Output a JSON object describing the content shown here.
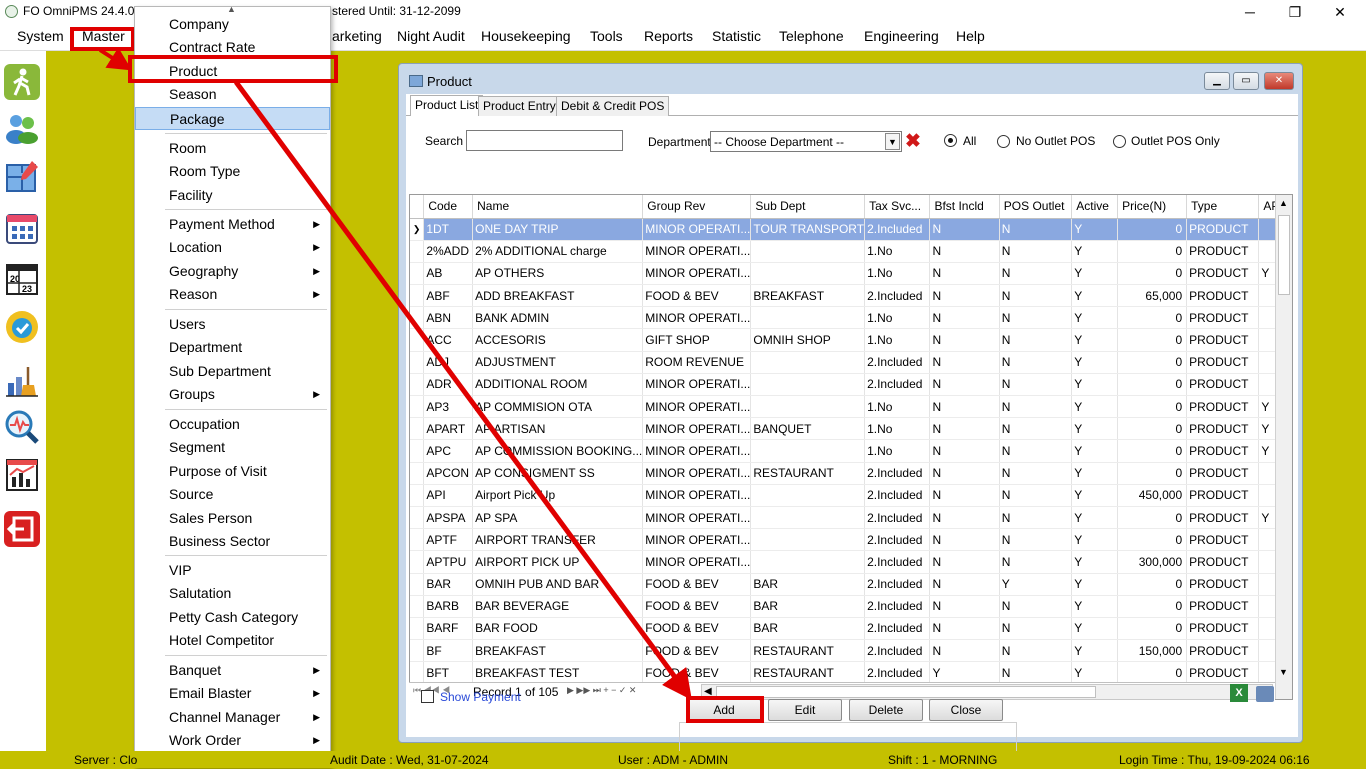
{
  "app": {
    "title": "FO OmniPMS 24.4.0.0",
    "title_tail": "stered Until: 31-12-2099"
  },
  "window_controls": {
    "minimize": "─",
    "maximize": "❐",
    "close": "✕"
  },
  "menubar": {
    "items": [
      "System",
      "Master",
      "arketing",
      "Night Audit",
      "Housekeeping",
      "Tools",
      "Reports",
      "Statistic",
      "Telephone",
      "Engineering",
      "Help"
    ]
  },
  "dropdown": {
    "items": [
      {
        "label": "Company"
      },
      {
        "label": "Contract Rate"
      },
      {
        "label": "Product"
      },
      {
        "label": "Season"
      },
      {
        "label": "Package"
      },
      {
        "label": "Room"
      },
      {
        "label": "Room Type"
      },
      {
        "label": "Facility"
      },
      {
        "label": "Payment Method",
        "sub": "▶"
      },
      {
        "label": "Location",
        "sub": "▶"
      },
      {
        "label": "Geography",
        "sub": "▶"
      },
      {
        "label": "Reason",
        "sub": "▶"
      },
      {
        "label": "Users"
      },
      {
        "label": "Department"
      },
      {
        "label": "Sub Department"
      },
      {
        "label": "Groups",
        "sub": "▶"
      },
      {
        "label": "Occupation"
      },
      {
        "label": "Segment"
      },
      {
        "label": "Purpose of Visit"
      },
      {
        "label": "Source"
      },
      {
        "label": "Sales Person"
      },
      {
        "label": "Business Sector"
      },
      {
        "label": "VIP"
      },
      {
        "label": "Salutation"
      },
      {
        "label": "Petty Cash Category"
      },
      {
        "label": "Hotel Competitor"
      },
      {
        "label": "Banquet",
        "sub": "▶"
      },
      {
        "label": "Email Blaster",
        "sub": "▶"
      },
      {
        "label": "Channel Manager",
        "sub": "▶"
      },
      {
        "label": "Work Order",
        "sub": "▶"
      }
    ]
  },
  "product_window": {
    "title": "Product",
    "tabs": [
      "Product List",
      "Product Entry",
      "Debit & Credit POS"
    ],
    "search_label": "Search",
    "search_value": "",
    "department_label": "Department",
    "department_value": "-- Choose Department --",
    "radio": [
      "All",
      "No Outlet POS",
      "Outlet POS Only"
    ],
    "columns": [
      "Code",
      "Name",
      "Group Rev",
      "Sub Dept",
      "Tax Svc...",
      "Bfst Incld",
      "POS Outlet",
      "Active",
      "Price(N)",
      "Type",
      "AP"
    ],
    "rows": [
      [
        "1DT",
        "ONE DAY TRIP",
        "MINOR OPERATI...",
        "TOUR TRANSPORT",
        "2.Included",
        "N",
        "N",
        "Y",
        "0",
        "PRODUCT",
        ""
      ],
      [
        "2%ADD",
        "2% ADDITIONAL charge",
        "MINOR OPERATI...",
        "",
        "1.No",
        "N",
        "N",
        "Y",
        "0",
        "PRODUCT",
        ""
      ],
      [
        "AB",
        "AP OTHERS",
        "MINOR OPERATI...",
        "",
        "1.No",
        "N",
        "N",
        "Y",
        "0",
        "PRODUCT",
        "Y"
      ],
      [
        "ABF",
        "ADD BREAKFAST",
        "FOOD & BEV",
        "BREAKFAST",
        "2.Included",
        "N",
        "N",
        "Y",
        "65,000",
        "PRODUCT",
        ""
      ],
      [
        "ABN",
        "BANK ADMIN",
        "MINOR OPERATI...",
        "",
        "1.No",
        "N",
        "N",
        "Y",
        "0",
        "PRODUCT",
        ""
      ],
      [
        "ACC",
        "ACCESORIS",
        "GIFT SHOP",
        "OMNIH SHOP",
        "1.No",
        "N",
        "N",
        "Y",
        "0",
        "PRODUCT",
        ""
      ],
      [
        "ADJ",
        "ADJUSTMENT",
        "ROOM REVENUE",
        "",
        "2.Included",
        "N",
        "N",
        "Y",
        "0",
        "PRODUCT",
        ""
      ],
      [
        "ADR",
        "ADDITIONAL ROOM",
        "MINOR OPERATI...",
        "",
        "2.Included",
        "N",
        "N",
        "Y",
        "0",
        "PRODUCT",
        ""
      ],
      [
        "AP3",
        "AP COMMISION OTA",
        "MINOR OPERATI...",
        "",
        "1.No",
        "N",
        "N",
        "Y",
        "0",
        "PRODUCT",
        "Y"
      ],
      [
        "APART",
        "AP ARTISAN",
        "MINOR OPERATI...",
        "BANQUET",
        "1.No",
        "N",
        "N",
        "Y",
        "0",
        "PRODUCT",
        "Y"
      ],
      [
        "APC",
        "AP COMMISSION BOOKING...",
        "MINOR OPERATI...",
        "",
        "1.No",
        "N",
        "N",
        "Y",
        "0",
        "PRODUCT",
        "Y"
      ],
      [
        "APCON",
        "AP CONSIGMENT SS",
        "MINOR OPERATI...",
        "RESTAURANT",
        "2.Included",
        "N",
        "N",
        "Y",
        "0",
        "PRODUCT",
        ""
      ],
      [
        "API",
        "Airport Pick Up",
        "MINOR OPERATI...",
        "",
        "2.Included",
        "N",
        "N",
        "Y",
        "450,000",
        "PRODUCT",
        ""
      ],
      [
        "APSPA",
        "AP SPA",
        "MINOR OPERATI...",
        "",
        "2.Included",
        "N",
        "N",
        "Y",
        "0",
        "PRODUCT",
        "Y"
      ],
      [
        "APTF",
        "AIRPORT TRANSFER",
        "MINOR OPERATI...",
        "",
        "2.Included",
        "N",
        "N",
        "Y",
        "0",
        "PRODUCT",
        ""
      ],
      [
        "APTPU",
        "AIRPORT PICK UP",
        "MINOR OPERATI...",
        "",
        "2.Included",
        "N",
        "N",
        "Y",
        "300,000",
        "PRODUCT",
        ""
      ],
      [
        "BAR",
        "OMNIH PUB AND BAR",
        "FOOD & BEV",
        "BAR",
        "2.Included",
        "N",
        "Y",
        "Y",
        "0",
        "PRODUCT",
        ""
      ],
      [
        "BARB",
        "BAR BEVERAGE",
        "FOOD & BEV",
        "BAR",
        "2.Included",
        "N",
        "N",
        "Y",
        "0",
        "PRODUCT",
        ""
      ],
      [
        "BARF",
        "BAR FOOD",
        "FOOD & BEV",
        "BAR",
        "2.Included",
        "N",
        "N",
        "Y",
        "0",
        "PRODUCT",
        ""
      ],
      [
        "BF",
        "BREAKFAST",
        "FOOD & BEV",
        "RESTAURANT",
        "2.Included",
        "N",
        "N",
        "Y",
        "150,000",
        "PRODUCT",
        ""
      ],
      [
        "BFT",
        "BREAKFAST TEST",
        "FOOD & BEV",
        "RESTAURANT",
        "2.Included",
        "Y",
        "N",
        "Y",
        "0",
        "PRODUCT",
        ""
      ]
    ],
    "record_text": "Record 1 of 105",
    "show_payment": "Show Payment",
    "buttons": {
      "add": "Add",
      "edit": "Edit",
      "delete": "Delete",
      "close": "Close"
    }
  },
  "statusbar": {
    "server": "Server : Clo",
    "audit": "Audit Date : Wed, 31-07-2024",
    "user": "User : ADM - ADMIN",
    "shift": "Shift : 1 - MORNING",
    "login": "Login Time : Thu, 19-09-2024 06:16"
  },
  "colors": {
    "background": "#c4c000",
    "highlight_box": "#e00000",
    "selected_row": "#8aa8e0"
  }
}
